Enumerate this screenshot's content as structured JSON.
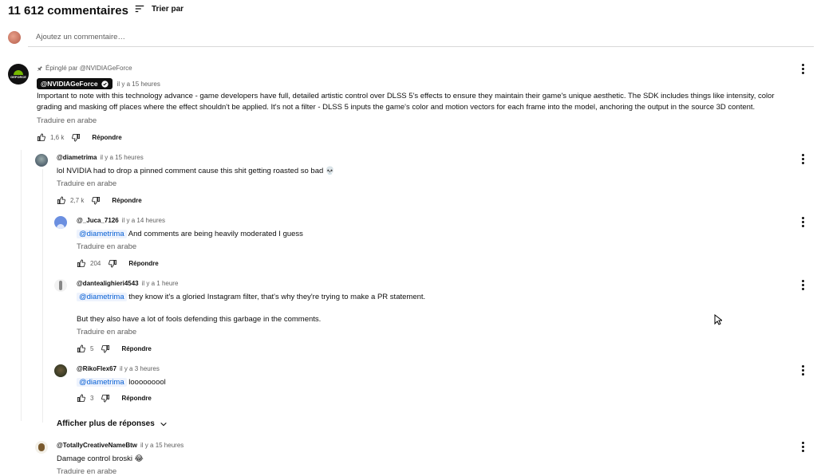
{
  "header": {
    "count": "11 612 commentaires",
    "sort_label": "Trier par"
  },
  "add_comment": {
    "placeholder": "Ajoutez un commentaire…"
  },
  "pinned": {
    "pinned_by": "Épinglé par @NVIDIAGeForce",
    "handle": "@NVIDIAGeForce",
    "time": "il y a 15 heures",
    "text": "Important to note with this technology advance - game developers have full, detailed artistic control over DLSS 5's effects to ensure they maintain their game's unique aesthetic. The SDK includes things like intensity, color grading and masking off places where the effect shouldn't be applied. It's not a filter - DLSS 5 inputs the game's color and motion vectors for each frame into the model, anchoring the output in the source 3D content.",
    "translate": "Traduire en arabe",
    "likes": "1,6 k",
    "reply": "Répondre"
  },
  "replies": [
    {
      "handle": "@diametrima",
      "time": "il y a 15 heures",
      "text": "lol NVIDIA had to drop a pinned comment cause this shit getting roasted so bad 💀",
      "translate": "Traduire en arabe",
      "likes": "2,7 k",
      "reply": "Répondre"
    },
    {
      "handle": "@_Juca_7126",
      "time": "il y a 14 heures",
      "mention": "@diametrima",
      "text": "And comments are being heavily moderated I guess",
      "translate": "Traduire en arabe",
      "likes": "204",
      "reply": "Répondre"
    },
    {
      "handle": "@dantealighieri4543",
      "time": "il y a 1 heure",
      "mention": "@diametrima",
      "text": "they know it's a gloried Instagram filter, that's why they're trying to make a PR statement.",
      "text2": "But they also have a lot of fools defending this garbage in the comments.",
      "translate": "Traduire en arabe",
      "likes": "5",
      "reply": "Répondre"
    },
    {
      "handle": "@RikoFlex67",
      "time": "il y a 3 heures",
      "mention": "@diametrima",
      "text": "looooooool",
      "likes": "3",
      "reply": "Répondre"
    }
  ],
  "more_replies": "Afficher plus de réponses",
  "next_comment": {
    "handle": "@TotallyCreativeNameBtw",
    "time": "il y a 15 heures",
    "text": "Damage control broski 😂",
    "translate": "Traduire en arabe"
  },
  "colors": {
    "mention": "#065fd4",
    "nvidia_green": "#76b900"
  }
}
